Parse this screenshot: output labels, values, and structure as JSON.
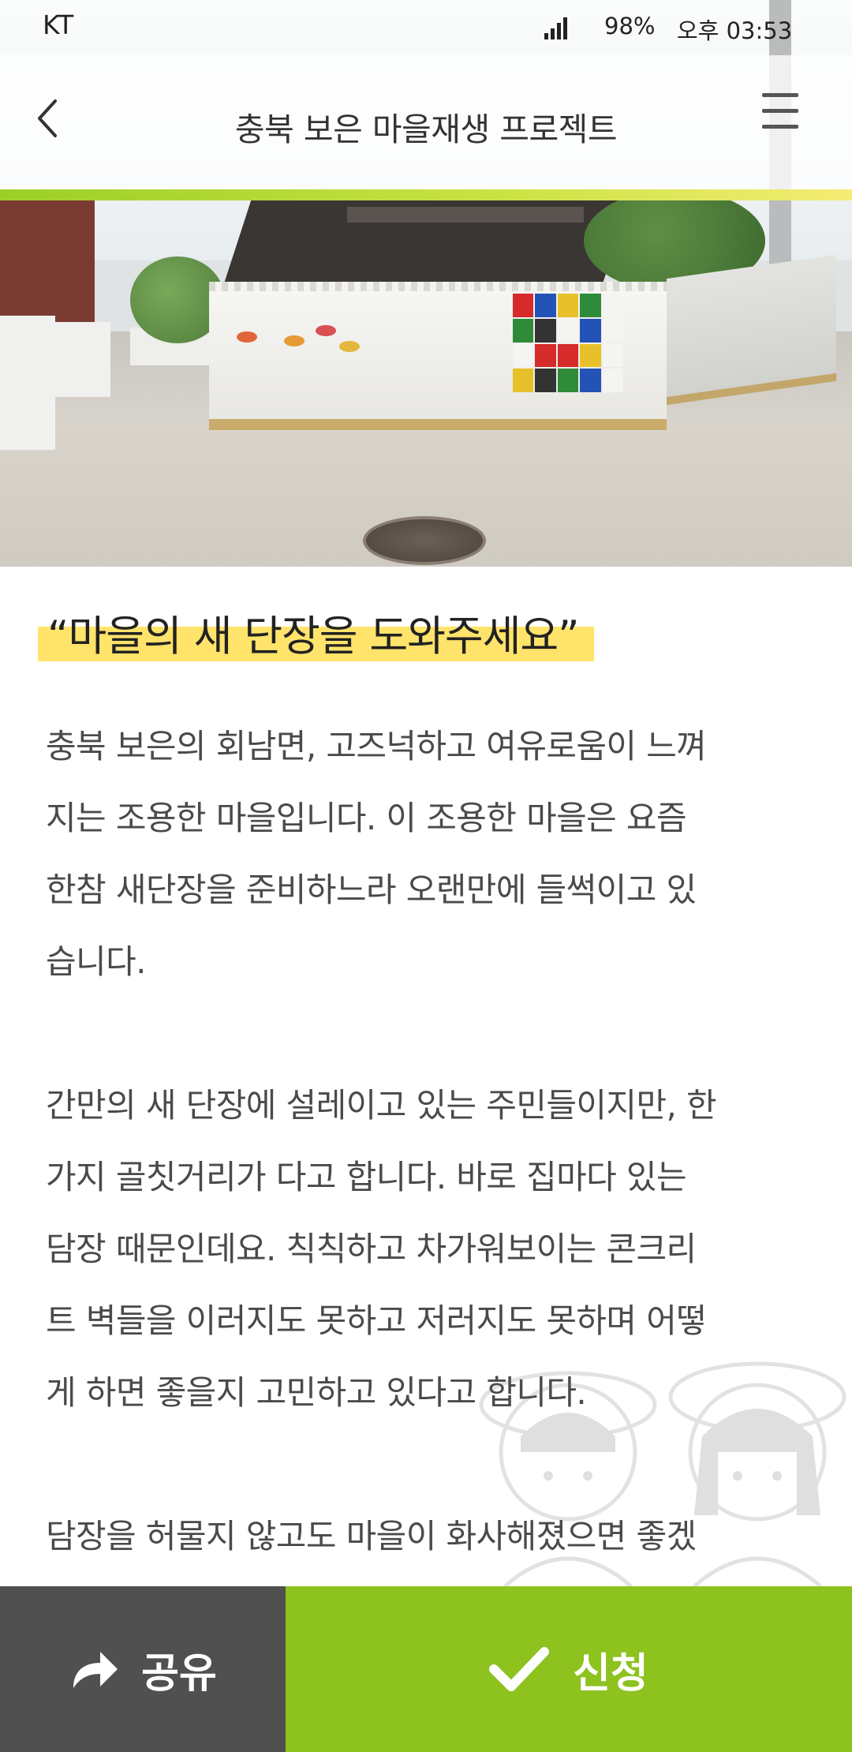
{
  "status_bar": {
    "carrier": "KT",
    "battery": "98%",
    "time": "오후 03:53"
  },
  "header": {
    "title": "충북 보은 마을재생 프로젝트",
    "accent_colors": [
      "#9ccf27",
      "#f4ec74"
    ]
  },
  "icons": {
    "back": "chevron-left-icon",
    "menu": "hamburger-menu-icon",
    "share": "share-arrow-icon",
    "apply": "checkmark-icon",
    "signal": "signal-icon"
  },
  "article": {
    "headline": "“마을의 새 단장을 도와주세요”",
    "paragraphs": [
      [
        "충북 보은의 회남면,  고즈넉하고 여유로움이 느껴",
        "지는 조용한 마을입니다. 이 조용한 마을은 요즘",
        "한참 새단장을 준비하느라 오랜만에 들썩이고 있",
        "습니다."
      ],
      [
        "간만의 새 단장에 설레이고 있는 주민들이지만, 한",
        "가지 골칫거리가 다고 합니다. 바로 집마다 있는",
        "담장 때문인데요. 칙칙하고 차가워보이는 콘크리",
        "트 벽들을 이러지도 못하고 저러지도 못하며 어떻",
        "게 하면 좋을지 고민하고 있다고 합니다."
      ],
      [
        "담장을 허물지 않고도 마을이 화사해졌으면 좋겠"
      ]
    ]
  },
  "actions": {
    "share_label": "공유",
    "apply_label": "신청",
    "share_color": "#505050",
    "apply_color": "#8dc21f"
  }
}
